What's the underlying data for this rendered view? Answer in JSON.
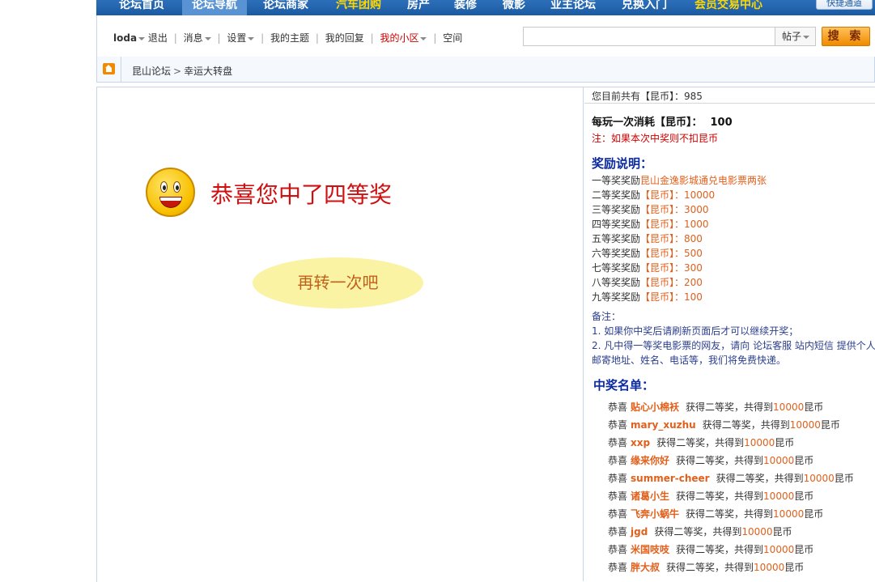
{
  "topnav": {
    "items": [
      "论坛首页",
      "论坛导航",
      "论坛商家",
      "汽车团购",
      "房产",
      "装修",
      "微影",
      "业主论坛",
      "兑换入门",
      "会员交易中心"
    ],
    "quick_label": "快捷通道"
  },
  "userbar": {
    "username": "loda",
    "logout": "退出",
    "messages": "消息",
    "settings": "设置",
    "my_topics": "我的主题",
    "my_replies": "我的回复",
    "my_community": "我的小区",
    "space": "空间"
  },
  "search": {
    "placeholder": "",
    "type": "帖子",
    "button": "搜 索"
  },
  "breadcrumb": [
    "昆山论坛",
    "幸运大转盘"
  ],
  "result": {
    "message": "恭喜您中了四等奖",
    "again": "再转一次吧"
  },
  "sidebar": {
    "coins_text": "您目前共有【昆币】：985",
    "cost_label": "每玩一次消耗【昆币】：",
    "cost_value": "100",
    "note": "注：如果本次中奖则不扣昆币",
    "rewards_title": "奖励说明：",
    "rewards": [
      {
        "level": "一等奖奖励",
        "detail": "昆山金逸影城通兑电影票两张"
      },
      {
        "level": "二等奖奖励",
        "detail": "【昆币】：10000"
      },
      {
        "level": "三等奖奖励",
        "detail": "【昆币】：3000"
      },
      {
        "level": "四等奖奖励",
        "detail": "【昆币】：1000"
      },
      {
        "level": "五等奖奖励",
        "detail": "【昆币】：800"
      },
      {
        "level": "六等奖奖励",
        "detail": "【昆币】：500"
      },
      {
        "level": "七等奖奖励",
        "detail": "【昆币】：300"
      },
      {
        "level": "八等奖奖励",
        "detail": "【昆币】：200"
      },
      {
        "level": "九等奖奖励",
        "detail": "【昆币】：100"
      }
    ],
    "remarks_title": "备注：",
    "remarks": [
      "1. 如果你中奖后请刷新页面后才可以继续开奖；",
      "2. 凡中得一等奖电影票的网友，请向 论坛客服 站内短信 提供个人邮寄地址、姓名、电话等，我们将免费快递。"
    ],
    "winners_title": "中奖名单：",
    "winners": [
      {
        "prefix": "恭喜",
        "name": "贴心小棉袄",
        "prize": "获得二等奖，共得到",
        "amount": "10000",
        "unit": "昆币"
      },
      {
        "prefix": "恭喜",
        "name": "mary_xuzhu",
        "prize": "获得二等奖，共得到",
        "amount": "10000",
        "unit": "昆币"
      },
      {
        "prefix": "恭喜",
        "name": "xxp",
        "prize": "获得二等奖，共得到",
        "amount": "10000",
        "unit": "昆币"
      },
      {
        "prefix": "恭喜",
        "name": "缘来你好",
        "prize": "获得二等奖，共得到",
        "amount": "10000",
        "unit": "昆币"
      },
      {
        "prefix": "恭喜",
        "name": "summer-cheer",
        "prize": "获得二等奖，共得到",
        "amount": "10000",
        "unit": "昆币"
      },
      {
        "prefix": "恭喜",
        "name": "诸葛小生",
        "prize": "获得二等奖，共得到",
        "amount": "10000",
        "unit": "昆币"
      },
      {
        "prefix": "恭喜",
        "name": "飞奔小蜗牛",
        "prize": "获得二等奖，共得到",
        "amount": "10000",
        "unit": "昆币"
      },
      {
        "prefix": "恭喜",
        "name": "jgd",
        "prize": "获得二等奖，共得到",
        "amount": "10000",
        "unit": "昆币"
      },
      {
        "prefix": "恭喜",
        "name": "米国吱吱",
        "prize": "获得二等奖，共得到",
        "amount": "10000",
        "unit": "昆币"
      },
      {
        "prefix": "恭喜",
        "name": "胖大叔",
        "prize": "获得二等奖，共得到",
        "amount": "10000",
        "unit": "昆币"
      }
    ]
  }
}
